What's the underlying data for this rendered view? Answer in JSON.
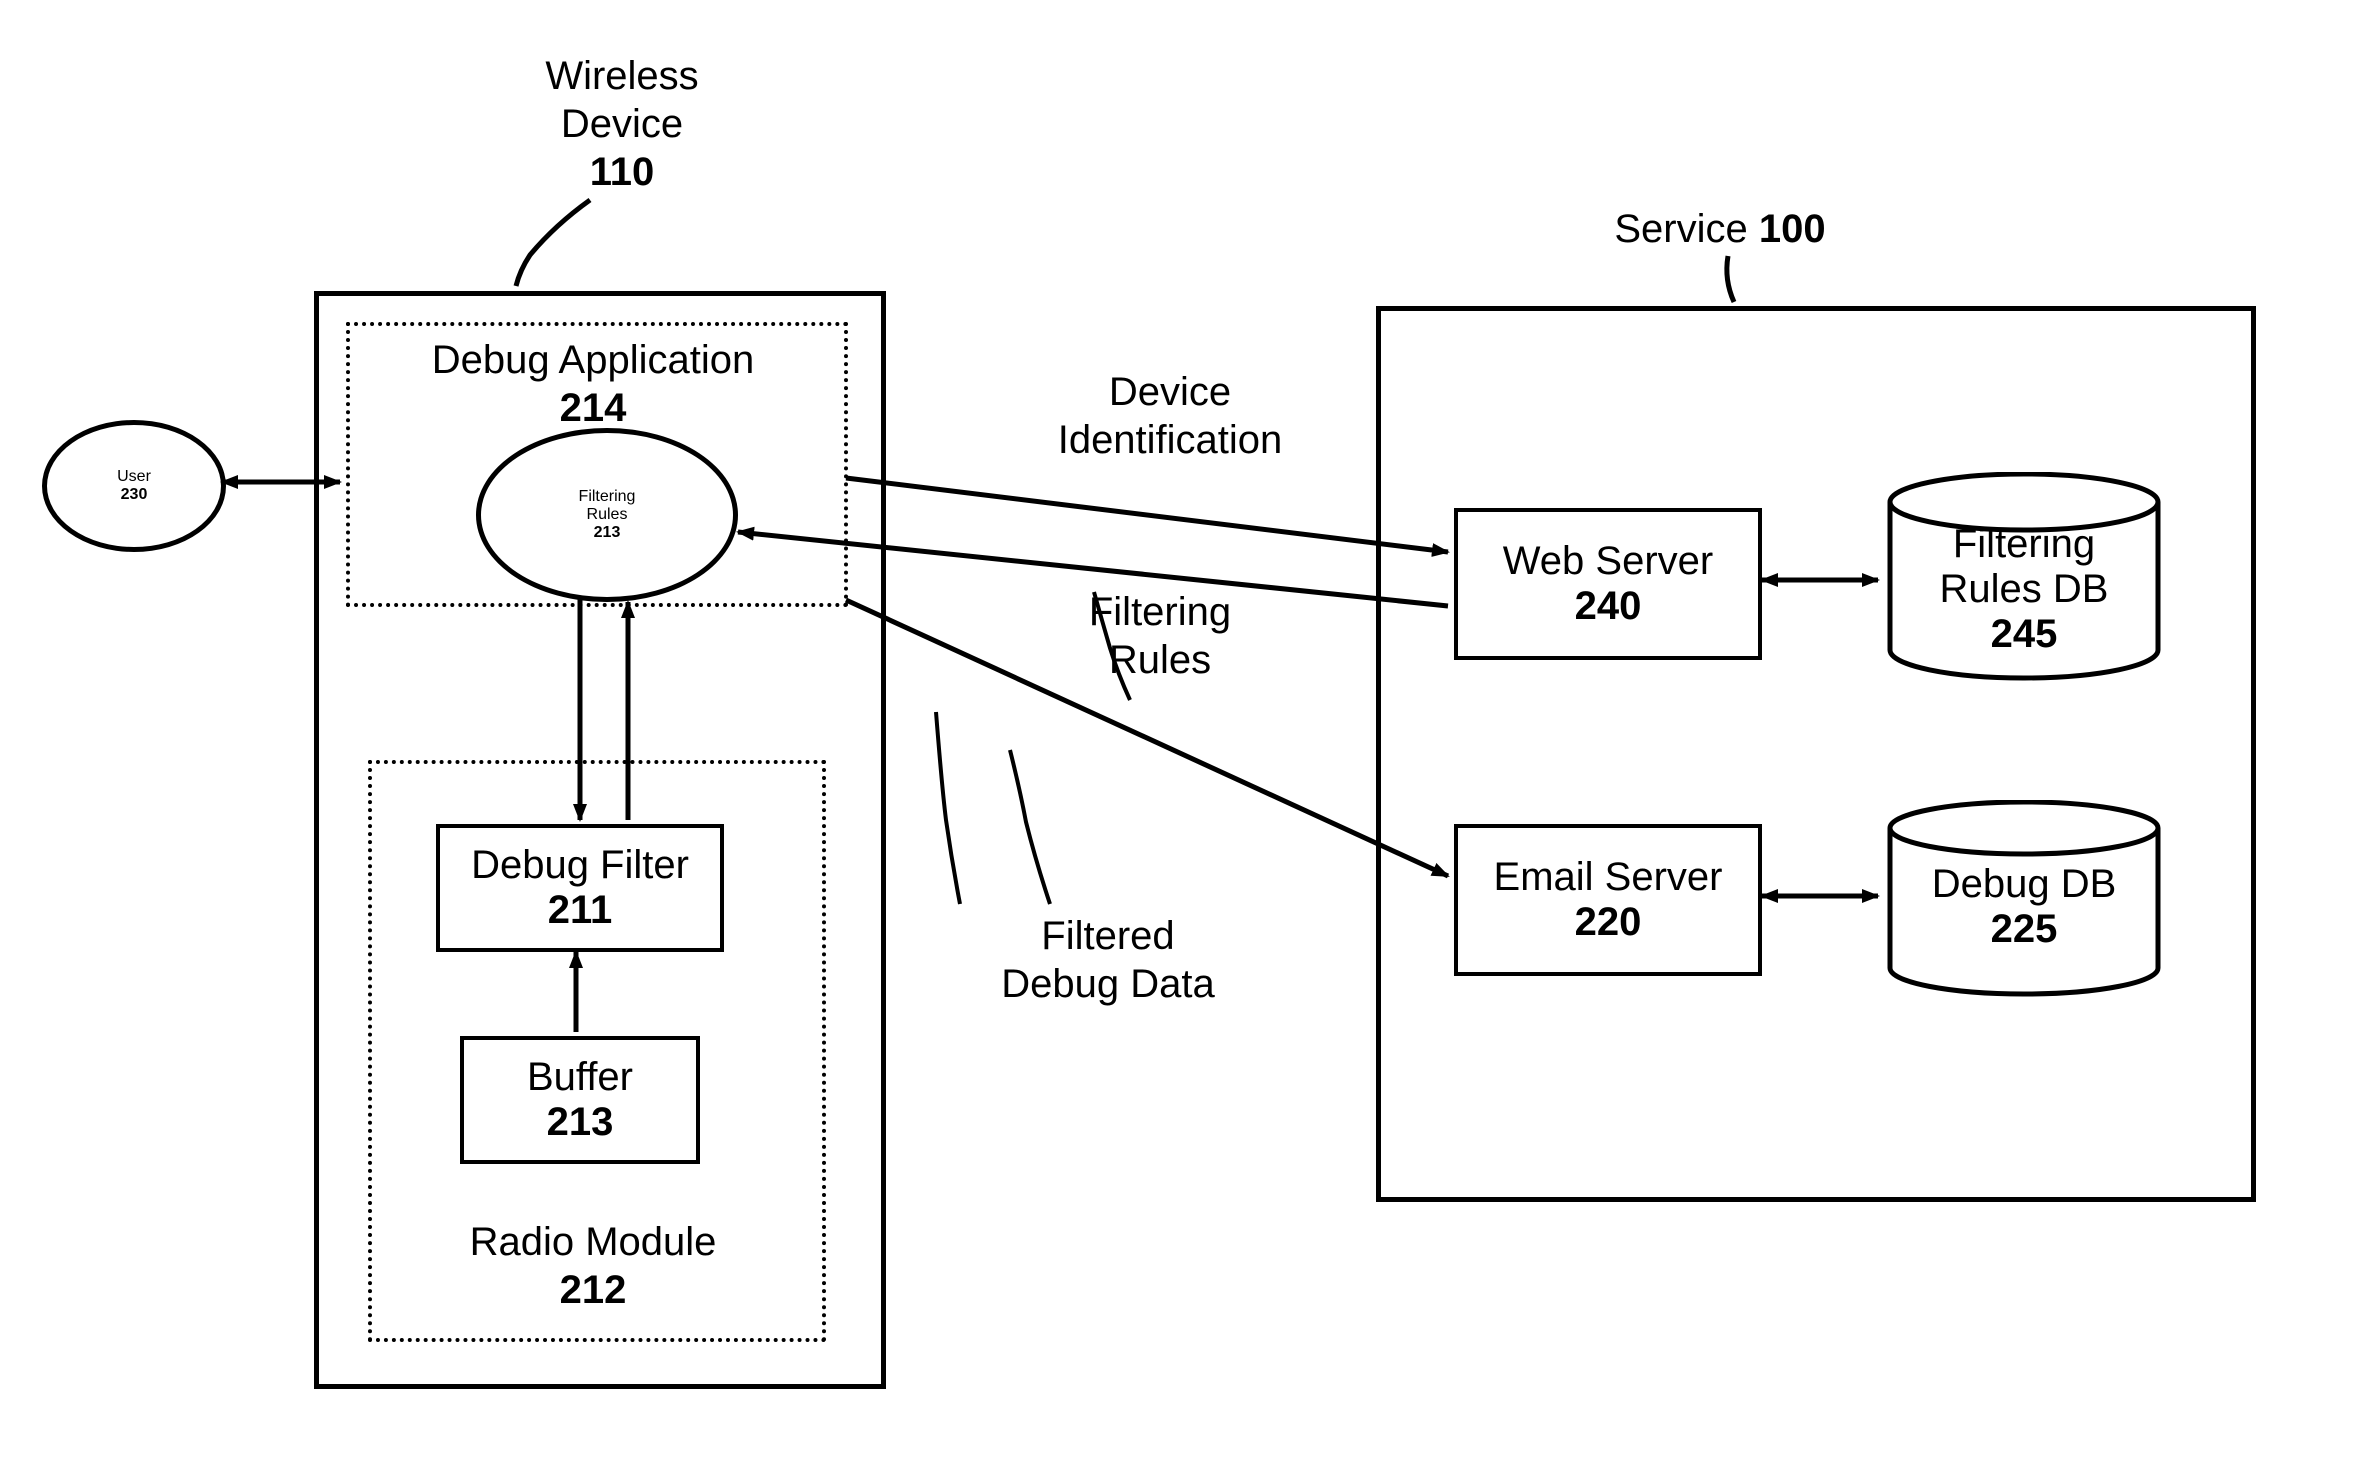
{
  "wirelessDevice": {
    "title": "Wireless\nDevice",
    "ref": "110"
  },
  "service": {
    "title": "Service",
    "ref": "100"
  },
  "user": {
    "name": "User",
    "ref": "230"
  },
  "debugApp": {
    "name": "Debug Application",
    "ref": "214"
  },
  "filteringRules": {
    "name": "Filtering\nRules",
    "ref": "213"
  },
  "radioModule": {
    "name": "Radio Module",
    "ref": "212"
  },
  "debugFilter": {
    "name": "Debug Filter",
    "ref": "211"
  },
  "buffer": {
    "name": "Buffer",
    "ref": "213"
  },
  "webServer": {
    "name": "Web Server",
    "ref": "240"
  },
  "emailServer": {
    "name": "Email Server",
    "ref": "220"
  },
  "rulesDB": {
    "name": "Filtering\nRules DB",
    "ref": "245"
  },
  "debugDB": {
    "name": "Debug DB",
    "ref": "225"
  },
  "edgeLabels": {
    "devId": "Device\nIdentification",
    "fr": "Filtering\nRules",
    "fdd": "Filtered\nDebug Data"
  }
}
